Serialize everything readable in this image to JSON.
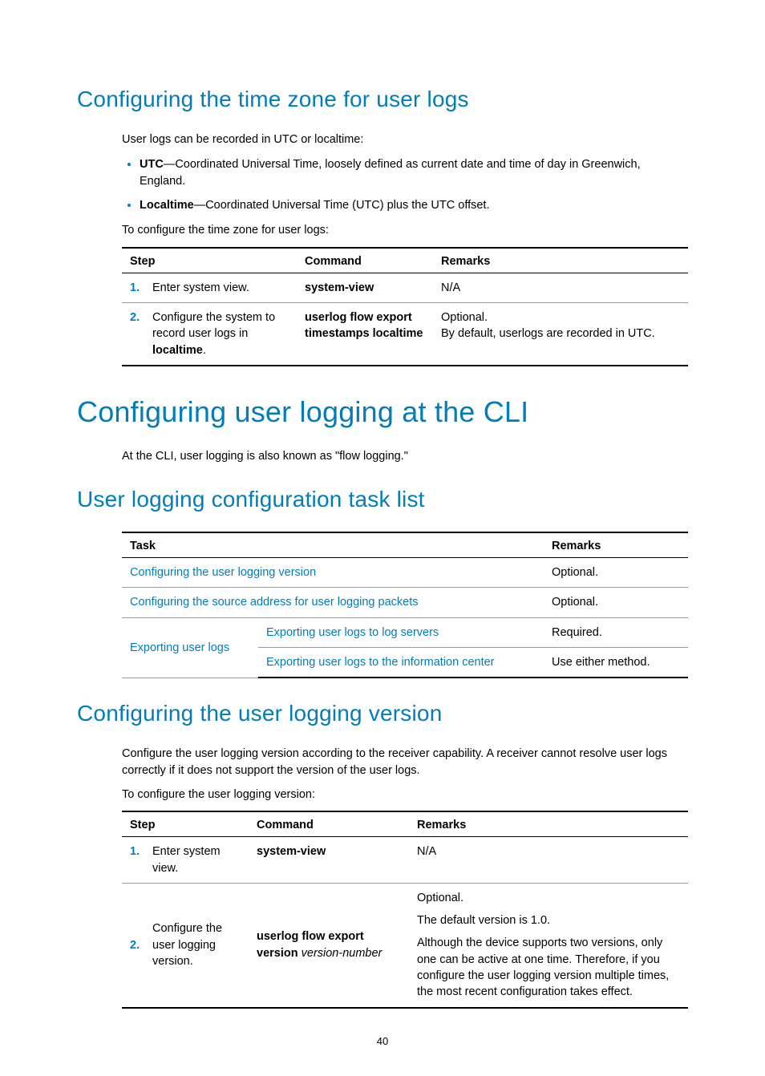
{
  "page_number": "40",
  "section1": {
    "heading": "Configuring the time zone for user logs",
    "intro": "User logs can be recorded in UTC or localtime:",
    "bullet1_bold": "UTC",
    "bullet1_rest": "—Coordinated Universal Time, loosely defined as current date and time of day in Greenwich, England.",
    "bullet2_bold": "Localtime",
    "bullet2_rest": "—Coordinated Universal Time (UTC) plus the UTC offset.",
    "lead": "To configure the time zone for user logs:",
    "table": {
      "head_step": "Step",
      "head_cmd": "Command",
      "head_rem": "Remarks",
      "r1_num": "1.",
      "r1_desc": "Enter system view.",
      "r1_cmd": "system-view",
      "r1_rem": "N/A",
      "r2_num": "2.",
      "r2_desc_a": "Configure the system to record user logs in ",
      "r2_desc_b": "localtime",
      "r2_desc_c": ".",
      "r2_cmd": "userlog flow export timestamps localtime",
      "r2_rem_a": "Optional.",
      "r2_rem_b": "By default, userlogs are recorded in UTC."
    }
  },
  "section2": {
    "heading": "Configuring user logging at the CLI",
    "intro": "At the CLI, user logging is also known as \"flow logging.\""
  },
  "section3": {
    "heading": "User logging configuration task list",
    "table": {
      "head_task": "Task",
      "head_rem": "Remarks",
      "r1_task": "Configuring the user logging version",
      "r1_rem": "Optional.",
      "r2_task": "Configuring the source address for user logging packets",
      "r2_rem": "Optional.",
      "r3_task_group": "Exporting user logs",
      "r3a_task": "Exporting user logs to log servers",
      "r3a_rem": "Required.",
      "r3b_task": "Exporting user logs to the information center",
      "r3b_rem": "Use either method."
    }
  },
  "section4": {
    "heading": "Configuring the user logging version",
    "intro": "Configure the user logging version according to the receiver capability. A receiver cannot resolve user logs correctly if it does not support the version of the user logs.",
    "lead": "To configure the user logging version:",
    "table": {
      "head_step": "Step",
      "head_cmd": "Command",
      "head_rem": "Remarks",
      "r1_num": "1.",
      "r1_desc": "Enter system view.",
      "r1_cmd": "system-view",
      "r1_rem": "N/A",
      "r2_num": "2.",
      "r2_desc": "Configure the user logging version.",
      "r2_cmd_a": "userlog flow export version",
      "r2_cmd_b": "version-number",
      "r2_rem_a": "Optional.",
      "r2_rem_b": "The default version is 1.0.",
      "r2_rem_c": "Although the device supports two versions, only one can be active at one time. Therefore, if you configure the user logging version multiple times, the most recent configuration takes effect."
    }
  }
}
